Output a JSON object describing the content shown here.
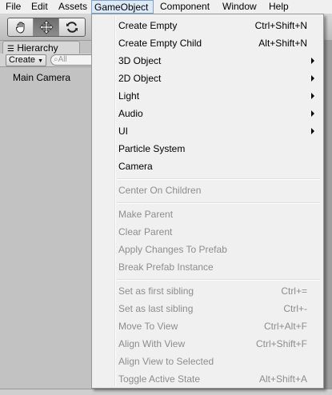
{
  "menubar": {
    "items": [
      "File",
      "Edit",
      "Assets",
      "GameObject",
      "Component",
      "Window",
      "Help"
    ]
  },
  "hierarchy": {
    "tab_label": "Hierarchy",
    "create_label": "Create",
    "search_placeholder": "All",
    "items": [
      "Main Camera"
    ]
  },
  "gameobject_menu": {
    "group1": [
      {
        "label": "Create Empty",
        "shortcut": "Ctrl+Shift+N"
      },
      {
        "label": "Create Empty Child",
        "shortcut": "Alt+Shift+N"
      },
      {
        "label": "3D Object",
        "submenu": true
      },
      {
        "label": "2D Object",
        "submenu": true
      },
      {
        "label": "Light",
        "submenu": true
      },
      {
        "label": "Audio",
        "submenu": true
      },
      {
        "label": "UI",
        "submenu": true
      },
      {
        "label": "Particle System"
      },
      {
        "label": "Camera"
      }
    ],
    "group2": [
      {
        "label": "Center On Children"
      }
    ],
    "group3": [
      {
        "label": "Make Parent"
      },
      {
        "label": "Clear Parent"
      },
      {
        "label": "Apply Changes To Prefab"
      },
      {
        "label": "Break Prefab Instance"
      }
    ],
    "group4": [
      {
        "label": "Set as first sibling",
        "shortcut": "Ctrl+="
      },
      {
        "label": "Set as last sibling",
        "shortcut": "Ctrl+-"
      },
      {
        "label": "Move To View",
        "shortcut": "Ctrl+Alt+F"
      },
      {
        "label": "Align With View",
        "shortcut": "Ctrl+Shift+F"
      },
      {
        "label": "Align View to Selected"
      },
      {
        "label": "Toggle Active State",
        "shortcut": "Alt+Shift+A"
      }
    ]
  }
}
